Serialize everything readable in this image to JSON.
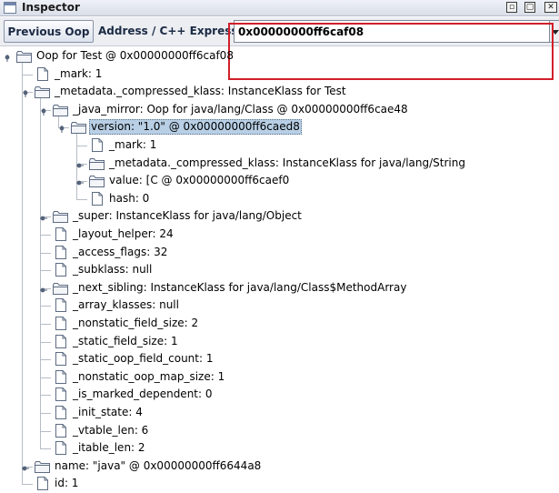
{
  "window": {
    "title": "Inspector",
    "min_icon": "minimize-icon",
    "max_icon": "maximize-icon",
    "close_icon": "close-icon"
  },
  "toolbar": {
    "prev_label": "Previous Oop",
    "address_label": "Address / C++ Expression:",
    "address_value": "0x00000000ff6caf08"
  },
  "tree": {
    "rows": [
      {
        "depth": 0,
        "type": "folder",
        "expanded": true,
        "text": "Oop for Test @ 0x00000000ff6caf08"
      },
      {
        "depth": 1,
        "type": "file",
        "expanded": false,
        "text": "_mark: 1"
      },
      {
        "depth": 1,
        "type": "folder",
        "expanded": true,
        "text": "_metadata._compressed_klass: InstanceKlass for Test"
      },
      {
        "depth": 2,
        "type": "folder",
        "expanded": true,
        "text": "_java_mirror: Oop for java/lang/Class @ 0x00000000ff6cae48"
      },
      {
        "depth": 3,
        "type": "folder",
        "expanded": true,
        "text": "version: \"1.0\" @ 0x00000000ff6caed8",
        "selected": true
      },
      {
        "depth": 4,
        "type": "file",
        "expanded": false,
        "text": "_mark: 1"
      },
      {
        "depth": 4,
        "type": "folder",
        "expanded": false,
        "text": "_metadata._compressed_klass: InstanceKlass for java/lang/String"
      },
      {
        "depth": 4,
        "type": "folder",
        "expanded": false,
        "text": "value: [C @ 0x00000000ff6caef0"
      },
      {
        "depth": 4,
        "type": "file",
        "expanded": false,
        "text": "hash: 0"
      },
      {
        "depth": 2,
        "type": "folder",
        "expanded": false,
        "text": "_super: InstanceKlass for java/lang/Object"
      },
      {
        "depth": 2,
        "type": "file",
        "expanded": false,
        "text": "_layout_helper: 24"
      },
      {
        "depth": 2,
        "type": "file",
        "expanded": false,
        "text": "_access_flags: 32"
      },
      {
        "depth": 2,
        "type": "file",
        "expanded": false,
        "text": "_subklass: null"
      },
      {
        "depth": 2,
        "type": "folder",
        "expanded": false,
        "text": "_next_sibling: InstanceKlass for java/lang/Class$MethodArray"
      },
      {
        "depth": 2,
        "type": "file",
        "expanded": false,
        "text": "_array_klasses: null"
      },
      {
        "depth": 2,
        "type": "file",
        "expanded": false,
        "text": "_nonstatic_field_size: 2"
      },
      {
        "depth": 2,
        "type": "file",
        "expanded": false,
        "text": "_static_field_size: 1"
      },
      {
        "depth": 2,
        "type": "file",
        "expanded": false,
        "text": "_static_oop_field_count: 1"
      },
      {
        "depth": 2,
        "type": "file",
        "expanded": false,
        "text": "_nonstatic_oop_map_size: 1"
      },
      {
        "depth": 2,
        "type": "file",
        "expanded": false,
        "text": "_is_marked_dependent: 0"
      },
      {
        "depth": 2,
        "type": "file",
        "expanded": false,
        "text": "_init_state: 4"
      },
      {
        "depth": 2,
        "type": "file",
        "expanded": false,
        "text": "_vtable_len: 6"
      },
      {
        "depth": 2,
        "type": "file",
        "expanded": false,
        "text": "_itable_len: 2"
      },
      {
        "depth": 1,
        "type": "folder",
        "expanded": false,
        "text": "name: \"java\" @ 0x00000000ff6644a8"
      },
      {
        "depth": 1,
        "type": "file",
        "expanded": false,
        "text": "id: 1"
      }
    ]
  },
  "colors": {
    "selection": "#b8cfe5",
    "highlight_box": "#d11f2a",
    "folder_fill": "#f3f5f9",
    "icon_stroke": "#5d6b82"
  }
}
